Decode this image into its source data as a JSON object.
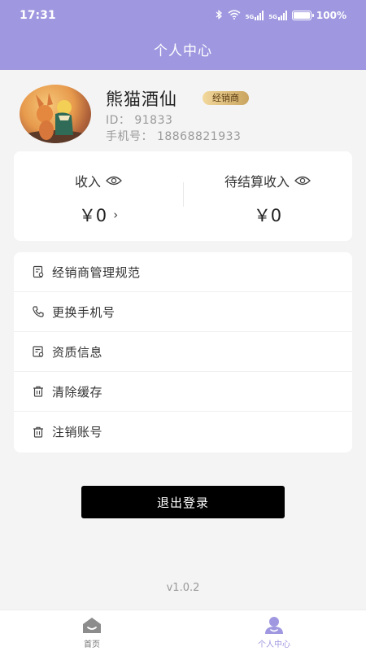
{
  "status_bar": {
    "time": "17:31",
    "battery_label": "100%",
    "network_label": "5G"
  },
  "header": {
    "title": "个人中心"
  },
  "profile": {
    "name": "熊猫酒仙",
    "badge": "经销商",
    "id_text": "ID：  91833",
    "phone_text": "手机号：  18868821933"
  },
  "income": {
    "income_label": "收入",
    "income_value": "￥0",
    "pending_label": "待结算收入",
    "pending_value": "￥0",
    "chevron": "›"
  },
  "menu": {
    "items": [
      {
        "label": "经销商管理规范",
        "icon": "document-icon"
      },
      {
        "label": "更换手机号",
        "icon": "phone-icon"
      },
      {
        "label": "资质信息",
        "icon": "certificate-icon"
      },
      {
        "label": "清除缓存",
        "icon": "trash-icon"
      },
      {
        "label": "注销账号",
        "icon": "trash-icon"
      }
    ]
  },
  "logout_label": "退出登录",
  "version": "v1.0.2",
  "tabbar": {
    "tabs": [
      {
        "label": "首页",
        "icon": "home-icon",
        "active": false
      },
      {
        "label": "个人中心",
        "icon": "user-icon",
        "active": true
      }
    ]
  },
  "colors": {
    "header_bg": "#9f98e0",
    "active_tab": "#9f98e0",
    "logout_bg": "#000000",
    "badge_gold": "#c9a45f"
  }
}
